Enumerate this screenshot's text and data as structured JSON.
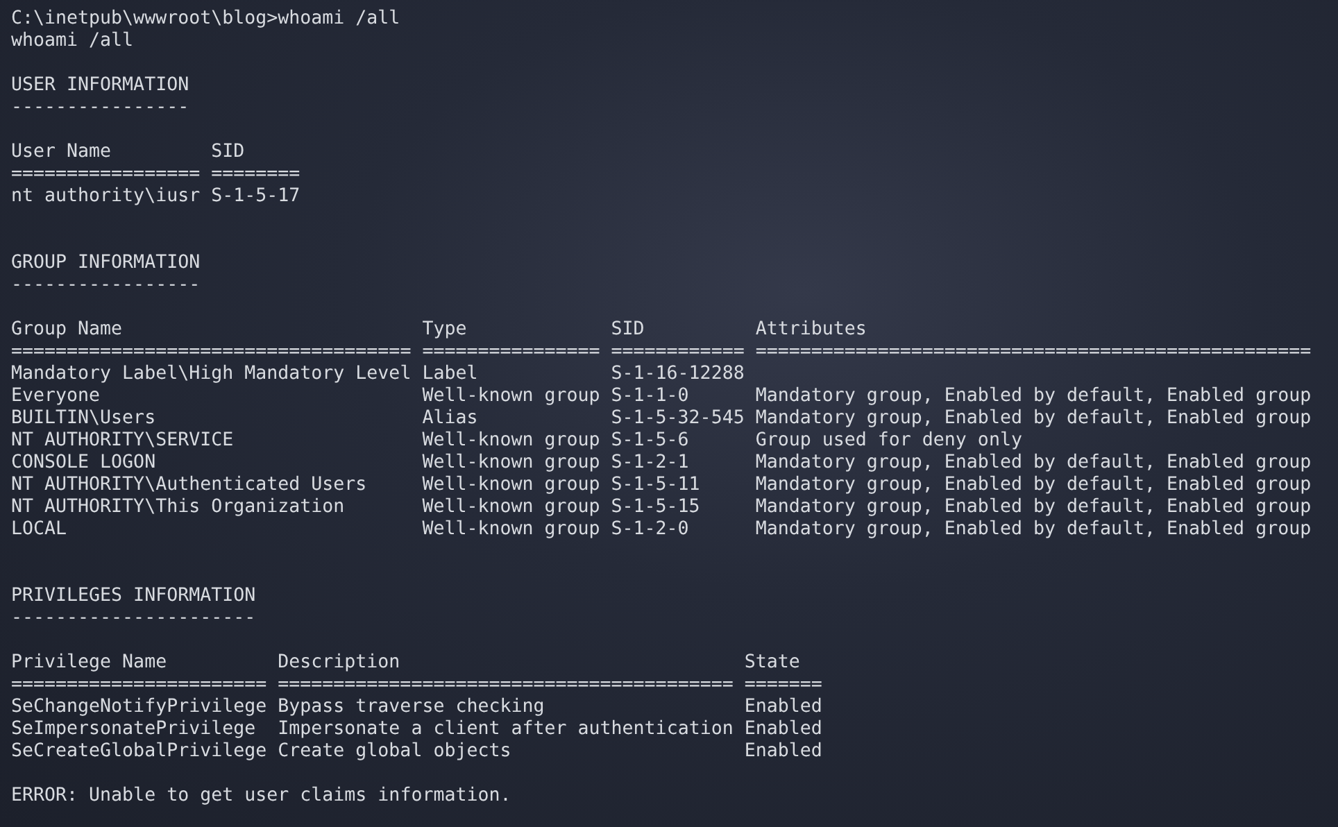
{
  "terminal": {
    "prompt": "C:\\inetpub\\wwwroot\\blog>whoami /all",
    "echo": "whoami /all",
    "sections": [
      {
        "title": "USER INFORMATION",
        "title_rule": "----------------",
        "columns": [
          {
            "header": "User Name",
            "rule": "================="
          },
          {
            "header": "SID",
            "rule": "========"
          }
        ],
        "rows": [
          [
            "nt authority\\iusr",
            "S-1-5-17"
          ]
        ]
      },
      {
        "title": "GROUP INFORMATION",
        "title_rule": "-----------------",
        "columns": [
          {
            "header": "Group Name",
            "rule": "===================================="
          },
          {
            "header": "Type",
            "rule": "================"
          },
          {
            "header": "SID",
            "rule": "============"
          },
          {
            "header": "Attributes",
            "rule": "=================================================="
          }
        ],
        "rows": [
          [
            "Mandatory Label\\High Mandatory Level",
            "Label",
            "S-1-16-12288",
            ""
          ],
          [
            "Everyone",
            "Well-known group",
            "S-1-1-0",
            "Mandatory group, Enabled by default, Enabled group"
          ],
          [
            "BUILTIN\\Users",
            "Alias",
            "S-1-5-32-545",
            "Mandatory group, Enabled by default, Enabled group"
          ],
          [
            "NT AUTHORITY\\SERVICE",
            "Well-known group",
            "S-1-5-6",
            "Group used for deny only"
          ],
          [
            "CONSOLE LOGON",
            "Well-known group",
            "S-1-2-1",
            "Mandatory group, Enabled by default, Enabled group"
          ],
          [
            "NT AUTHORITY\\Authenticated Users",
            "Well-known group",
            "S-1-5-11",
            "Mandatory group, Enabled by default, Enabled group"
          ],
          [
            "NT AUTHORITY\\This Organization",
            "Well-known group",
            "S-1-5-15",
            "Mandatory group, Enabled by default, Enabled group"
          ],
          [
            "LOCAL",
            "Well-known group",
            "S-1-2-0",
            "Mandatory group, Enabled by default, Enabled group"
          ]
        ]
      },
      {
        "title": "PRIVILEGES INFORMATION",
        "title_rule": "----------------------",
        "columns": [
          {
            "header": "Privilege Name",
            "rule": "======================="
          },
          {
            "header": "Description",
            "rule": "========================================="
          },
          {
            "header": "State",
            "rule": "======="
          }
        ],
        "rows": [
          [
            "SeChangeNotifyPrivilege",
            "Bypass traverse checking",
            "Enabled"
          ],
          [
            "SeImpersonatePrivilege",
            "Impersonate a client after authentication",
            "Enabled"
          ],
          [
            "SeCreateGlobalPrivilege",
            "Create global objects",
            "Enabled"
          ]
        ]
      }
    ],
    "error": "ERROR: Unable to get user claims information."
  }
}
